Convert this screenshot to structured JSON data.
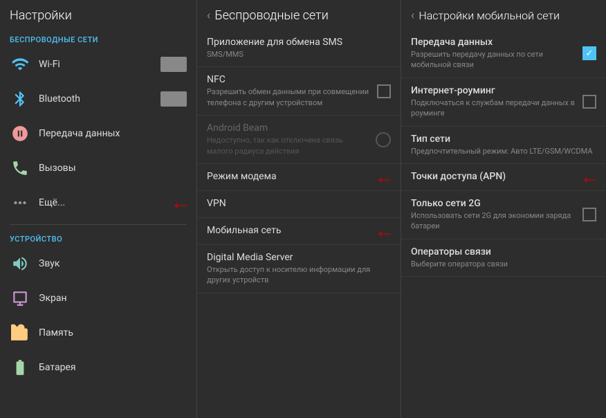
{
  "left_panel": {
    "title": "Настройки",
    "sections": [
      {
        "label": "БЕСПРОВОДНЫЕ СЕТИ",
        "items": [
          {
            "id": "wifi",
            "label": "Wi-Fi",
            "icon": "wifi",
            "has_toggle": true
          },
          {
            "id": "bluetooth",
            "label": "Bluetooth",
            "icon": "bluetooth",
            "has_toggle": true
          },
          {
            "id": "data",
            "label": "Передача данных",
            "icon": "data",
            "has_toggle": false
          },
          {
            "id": "calls",
            "label": "Вызовы",
            "icon": "calls",
            "has_toggle": false
          },
          {
            "id": "more",
            "label": "Ещё...",
            "icon": "more",
            "has_toggle": false,
            "has_red_arrow": true
          }
        ]
      },
      {
        "label": "УСТРОЙСТВО",
        "items": [
          {
            "id": "sound",
            "label": "Звук",
            "icon": "sound",
            "has_toggle": false
          },
          {
            "id": "display",
            "label": "Экран",
            "icon": "display",
            "has_toggle": false
          },
          {
            "id": "memory",
            "label": "Память",
            "icon": "memory",
            "has_toggle": false
          },
          {
            "id": "battery",
            "label": "Батарея",
            "icon": "battery",
            "has_toggle": false
          }
        ]
      }
    ]
  },
  "middle_panel": {
    "title": "Беспроводные сети",
    "items": [
      {
        "id": "sms",
        "title": "Приложение для обмена SMS",
        "subtitle": "SMS/MMS",
        "disabled": false,
        "has_checkbox": false
      },
      {
        "id": "nfc",
        "title": "NFC",
        "subtitle": "Разрешить обмен данными при совмещении телефона с другим устройством",
        "disabled": false,
        "has_checkbox": true,
        "checked": false
      },
      {
        "id": "android_beam",
        "title": "Android Beam",
        "subtitle": "Недоступно, так как отключена связь малого радиуса действия",
        "disabled": true,
        "has_checkbox": true,
        "checked": false,
        "circle_checkbox": true
      },
      {
        "id": "modem",
        "title": "Режим модема",
        "subtitle": "",
        "disabled": false,
        "has_checkbox": false,
        "has_red_arrow": true
      },
      {
        "id": "vpn",
        "title": "VPN",
        "subtitle": "",
        "disabled": false,
        "has_checkbox": false
      },
      {
        "id": "mobile_network",
        "title": "Мобильная сеть",
        "subtitle": "",
        "disabled": false,
        "has_checkbox": false,
        "has_red_arrow": true
      },
      {
        "id": "dms",
        "title": "Digital Media Server",
        "subtitle": "Открыть доступ к носителю информации для других устройств",
        "disabled": false,
        "has_checkbox": false
      }
    ]
  },
  "right_panel": {
    "title": "Настройки мобильной сети",
    "items": [
      {
        "id": "data_transfer",
        "title": "Передача данных",
        "subtitle": "Разрешить передачу данных по сети мобильной связи",
        "has_checkbox": true,
        "checked": true
      },
      {
        "id": "roaming",
        "title": "Интернет-роуминг",
        "subtitle": "Подключаться к службам передачи данных в роуминге",
        "has_checkbox": true,
        "checked": false
      },
      {
        "id": "network_type",
        "title": "Тип сети",
        "subtitle": "Предпочтительный режим: Авто LTE/GSM/WCDMA",
        "has_checkbox": false
      },
      {
        "id": "apn",
        "title": "Точки доступа (APN)",
        "subtitle": "",
        "has_checkbox": false,
        "has_red_arrow": true
      },
      {
        "id": "only_2g",
        "title": "Только сети 2G",
        "subtitle": "Использовать сети 2G для экономии заряда батареи",
        "has_checkbox": true,
        "checked": false
      },
      {
        "id": "operators",
        "title": "Операторы связи",
        "subtitle": "Выберите оператора связи",
        "has_checkbox": false
      }
    ]
  }
}
